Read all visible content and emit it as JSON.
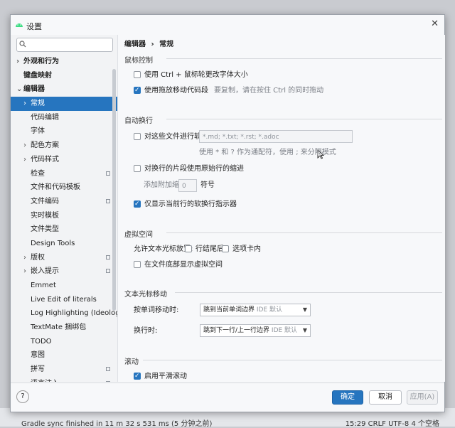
{
  "window": {
    "title": "设置"
  },
  "search": {
    "placeholder": "",
    "icon": "search-icon"
  },
  "breadcrumb": {
    "parent": "编辑器",
    "sep": "›",
    "current": "常规"
  },
  "sidebar": {
    "items": [
      {
        "label": "外观和行为",
        "indent": 0,
        "chevron": "›",
        "bold": true
      },
      {
        "label": "键盘映射",
        "indent": 0,
        "chevron": "",
        "bold": true
      },
      {
        "label": "编辑器",
        "indent": 0,
        "chevron": "⌄",
        "bold": true
      },
      {
        "label": "常规",
        "indent": 1,
        "chevron": "›",
        "selected": true
      },
      {
        "label": "代码编辑",
        "indent": 1,
        "chevron": ""
      },
      {
        "label": "字体",
        "indent": 1,
        "chevron": ""
      },
      {
        "label": "配色方案",
        "indent": 1,
        "chevron": "›"
      },
      {
        "label": "代码样式",
        "indent": 1,
        "chevron": "›"
      },
      {
        "label": "检查",
        "indent": 1,
        "chevron": "",
        "proj": true
      },
      {
        "label": "文件和代码模板",
        "indent": 1,
        "chevron": ""
      },
      {
        "label": "文件编码",
        "indent": 1,
        "chevron": "",
        "proj": true
      },
      {
        "label": "实时模板",
        "indent": 1,
        "chevron": ""
      },
      {
        "label": "文件类型",
        "indent": 1,
        "chevron": ""
      },
      {
        "label": "Design Tools",
        "indent": 1,
        "chevron": ""
      },
      {
        "label": "版权",
        "indent": 1,
        "chevron": "›",
        "proj": true
      },
      {
        "label": "嵌入提示",
        "indent": 1,
        "chevron": "›",
        "proj": true
      },
      {
        "label": "Emmet",
        "indent": 1,
        "chevron": ""
      },
      {
        "label": "Live Edit of literals",
        "indent": 1,
        "chevron": ""
      },
      {
        "label": "Log Highlighting (Ideolog)",
        "indent": 1,
        "chevron": ""
      },
      {
        "label": "TextMate 捆绑包",
        "indent": 1,
        "chevron": ""
      },
      {
        "label": "TODO",
        "indent": 1,
        "chevron": ""
      },
      {
        "label": "意图",
        "indent": 1,
        "chevron": ""
      },
      {
        "label": "拼写",
        "indent": 1,
        "chevron": "",
        "proj": true
      },
      {
        "label": "语言注入",
        "indent": 1,
        "chevron": "›",
        "proj": true
      }
    ]
  },
  "sections": {
    "mouse": {
      "title": "鼠标控制",
      "ctrl_wheel": {
        "label": "使用 Ctrl + 鼠标轮更改字体大小",
        "checked": false
      },
      "drag_drop": {
        "label": "使用拖放移动代码段",
        "hint": "要复制，请在按住 Ctrl 的同时拖动",
        "checked": true
      }
    },
    "softwrap": {
      "title": "自动换行",
      "files": {
        "label": "对这些文件进行软换行:",
        "value": "*.md; *.txt; *.rst; *.adoc",
        "checked": false
      },
      "files_hint": "使用 * 和 ? 作为通配符，使用 ; 来分隔模式",
      "indent": {
        "label": "对换行的片段使用原始行的缩进",
        "checked": false
      },
      "extra_indent": {
        "label": "添加附加缩进:",
        "value": "0",
        "unit": "符号"
      },
      "current_only": {
        "label": "仅显示当前行的软换行指示器",
        "checked": true
      }
    },
    "virtual": {
      "title": "虚拟空间",
      "allow_label": "允许文本光标放置:",
      "after_line_end": {
        "label": "行结尾后",
        "checked": false
      },
      "inside_tabs": {
        "label": "选项卡内",
        "checked": false
      },
      "file_end": {
        "label": "在文件底部显示虚拟空间",
        "checked": false
      }
    },
    "caret": {
      "title": "文本光标移动",
      "word_label": "按单词移动时:",
      "word_value": "跳到当前单词边界",
      "word_hint": "IDE 默认",
      "line_label": "换行时:",
      "line_value": "跳到下一行/上一行边界",
      "line_hint": "IDE 默认"
    },
    "scroll": {
      "title": "滚动",
      "smooth": {
        "label": "启用平滑滚动",
        "checked": true
      }
    }
  },
  "footer": {
    "help": "?",
    "ok": "确定",
    "cancel": "取消",
    "apply": "应用(A)"
  },
  "ide_strip": {
    "left": "Gradle sync finished in 11 m 32 s 531 ms (5 分钟之前)",
    "right": "15:29   CRLF   UTF-8   4 个空格"
  },
  "colors": {
    "accent": "#2675bf",
    "selection": "#2675bf"
  }
}
